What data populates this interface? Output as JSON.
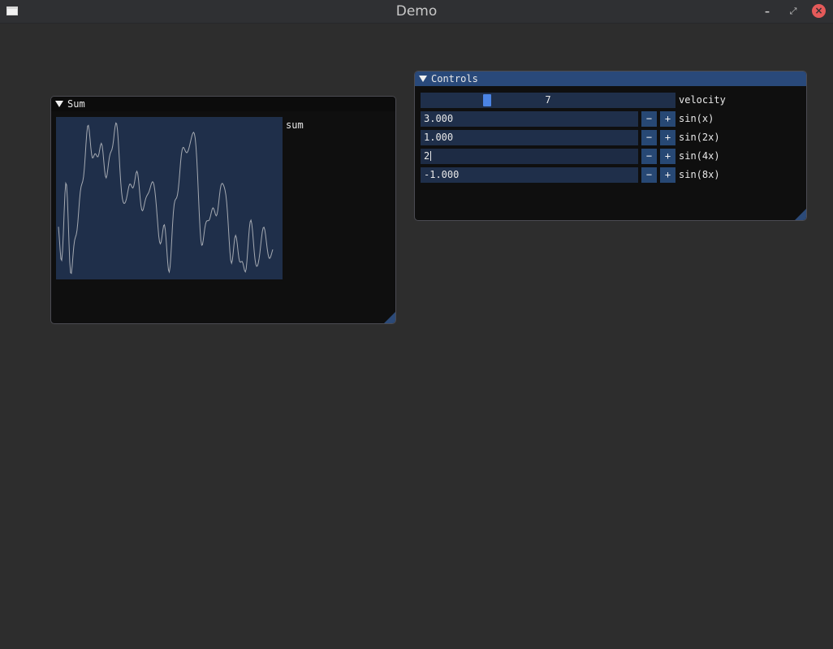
{
  "window": {
    "title": "Demo",
    "minimize": "–",
    "restore": "⤢",
    "close": "×"
  },
  "sum_window": {
    "title": "Sum",
    "plot_label": "sum",
    "chart_data": {
      "type": "line",
      "title": "",
      "xlabel": "",
      "ylabel": "",
      "x": [
        0,
        1,
        2,
        3,
        4,
        5,
        6,
        7,
        8,
        9,
        10,
        11,
        12,
        13,
        14,
        15,
        16,
        17,
        18,
        19,
        20,
        21,
        22,
        23,
        24,
        25,
        26,
        27,
        28,
        29,
        30,
        31,
        32,
        33,
        34,
        35,
        36,
        37,
        38,
        39,
        40,
        41,
        42,
        43,
        44,
        45,
        46,
        47,
        48,
        49,
        50,
        51,
        52,
        53,
        54,
        55,
        56,
        57,
        58,
        59,
        60,
        61,
        62,
        63,
        64,
        65,
        66,
        67,
        68,
        69,
        70,
        71,
        72,
        73,
        74,
        75,
        76,
        77,
        78,
        79,
        80,
        81,
        82,
        83,
        84,
        85,
        86,
        87,
        88,
        89,
        90,
        91,
        92,
        93,
        94,
        95,
        96,
        97,
        98,
        99,
        100,
        101,
        102,
        103,
        104,
        105,
        106,
        107,
        108,
        109,
        110,
        111,
        112,
        113,
        114,
        115,
        116,
        117,
        118,
        119,
        120,
        121,
        122,
        123,
        124,
        125,
        126,
        127,
        128,
        129,
        130,
        131,
        132,
        133,
        134,
        135,
        136,
        137,
        138,
        139,
        140,
        141,
        142,
        143,
        144,
        145,
        146,
        147,
        148,
        149,
        150,
        151,
        152,
        153,
        154,
        155,
        156,
        157,
        158,
        159,
        160,
        161,
        162,
        163,
        164,
        165,
        166,
        167,
        168,
        169,
        170,
        171,
        172,
        173,
        174,
        175,
        176,
        177,
        178,
        179,
        180,
        181,
        182,
        183,
        184,
        185,
        186,
        187,
        188,
        189,
        190,
        191,
        192,
        193,
        194,
        195,
        196,
        197,
        198,
        199,
        200,
        201,
        202,
        203,
        204,
        205,
        206,
        207,
        208,
        209,
        210,
        211,
        212,
        213,
        214,
        215,
        216,
        217,
        218,
        219,
        220,
        221,
        222,
        223,
        224,
        225,
        226,
        227,
        228,
        229,
        230,
        231,
        232,
        233,
        234,
        235,
        236,
        237,
        238,
        239,
        240,
        241,
        242,
        243,
        244,
        245,
        246,
        247,
        248,
        249,
        250,
        251,
        252,
        253,
        254,
        255,
        256,
        257,
        258,
        259,
        260,
        261,
        262,
        263,
        264,
        265,
        266,
        267,
        268,
        269,
        270,
        271,
        272,
        273,
        274
      ],
      "series": [
        {
          "values": [
            0.5,
            -0.33,
            -1.25,
            -2.0,
            -2.12,
            -1.43,
            -0.07,
            1.63,
            3.11,
            3.9,
            3.76,
            2.73,
            1.06,
            -0.77,
            -2.27,
            -3.09,
            -3.14,
            -2.58,
            -1.76,
            -1.03,
            -0.55,
            -0.31,
            -0.12,
            0.24,
            0.87,
            1.71,
            2.56,
            3.23,
            3.64,
            3.86,
            4.05,
            4.41,
            5.05,
            5.96,
            6.96,
            7.83,
            8.36,
            8.42,
            8.04,
            7.38,
            6.67,
            6.13,
            5.88,
            5.9,
            6.06,
            6.2,
            6.2,
            6.09,
            5.97,
            5.98,
            6.18,
            6.52,
            6.87,
            7.02,
            6.85,
            6.35,
            5.64,
            4.94,
            4.46,
            4.32,
            4.54,
            5.0,
            5.53,
            5.96,
            6.23,
            6.38,
            6.52,
            6.8,
            7.24,
            7.8,
            8.31,
            8.61,
            8.55,
            8.07,
            7.22,
            6.13,
            5.0,
            3.99,
            3.22,
            2.71,
            2.43,
            2.33,
            2.34,
            2.46,
            2.68,
            2.99,
            3.34,
            3.65,
            3.83,
            3.84,
            3.72,
            3.58,
            3.53,
            3.66,
            3.98,
            4.38,
            4.71,
            4.84,
            4.67,
            4.19,
            3.5,
            2.77,
            2.17,
            1.82,
            1.75,
            1.9,
            2.19,
            2.49,
            2.73,
            2.89,
            3.0,
            3.11,
            3.25,
            3.45,
            3.68,
            3.89,
            4.01,
            3.99,
            3.79,
            3.39,
            2.82,
            2.1,
            1.29,
            0.48,
            -0.21,
            -0.67,
            -0.83,
            -0.69,
            -0.3,
            0.2,
            0.59,
            0.66,
            0.32,
            -0.4,
            -1.34,
            -2.25,
            -2.88,
            -3.03,
            -2.62,
            -1.73,
            -0.56,
            0.63,
            1.6,
            2.24,
            2.56,
            2.67,
            2.75,
            2.97,
            3.39,
            4.03,
            4.79,
            5.53,
            6.15,
            6.54,
            6.7,
            6.68,
            6.55,
            6.4,
            6.3,
            6.29,
            6.39,
            6.57,
            6.81,
            7.08,
            7.35,
            7.61,
            7.8,
            7.88,
            7.78,
            7.43,
            6.76,
            5.77,
            4.48,
            3.01,
            1.56,
            0.32,
            -0.55,
            -0.94,
            -0.9,
            -0.55,
            -0.06,
            0.41,
            0.75,
            0.93,
            0.98,
            0.97,
            0.99,
            1.11,
            1.34,
            1.63,
            1.87,
            1.98,
            1.91,
            1.71,
            1.48,
            1.36,
            1.46,
            1.81,
            2.34,
            2.93,
            3.43,
            3.76,
            3.89,
            3.87,
            3.75,
            3.58,
            3.35,
            2.99,
            2.41,
            1.6,
            0.59,
            -0.49,
            -1.46,
            -2.12,
            -2.35,
            -2.12,
            -1.55,
            -0.89,
            -0.37,
            -0.17,
            -0.35,
            -0.82,
            -1.42,
            -1.93,
            -2.22,
            -2.27,
            -2.22,
            -2.2,
            -2.34,
            -2.62,
            -2.91,
            -3.02,
            -2.8,
            -2.21,
            -1.36,
            -0.43,
            0.37,
            0.89,
            1.02,
            0.75,
            0.15,
            -0.64,
            -1.42,
            -2.04,
            -2.43,
            -2.59,
            -2.55,
            -2.34,
            -1.99,
            -1.52,
            -0.94,
            -0.36,
            0.12,
            0.42,
            0.47,
            0.27,
            -0.14,
            -0.67,
            -1.2,
            -1.62,
            -1.89,
            -1.97,
            -1.9,
            -1.71,
            -1.48,
            -1.27
          ]
        }
      ]
    }
  },
  "controls_window": {
    "title": "Controls",
    "slider": {
      "value": "7",
      "label": "velocity",
      "level": 0.25
    },
    "rows": [
      {
        "value": "3.000",
        "label": "sin(x)"
      },
      {
        "value": "1.000",
        "label": "sin(2x)"
      },
      {
        "value": "2",
        "label": "sin(4x)"
      },
      {
        "value": "-1.000",
        "label": "sin(8x)"
      }
    ],
    "minus": "−",
    "plus": "+"
  }
}
